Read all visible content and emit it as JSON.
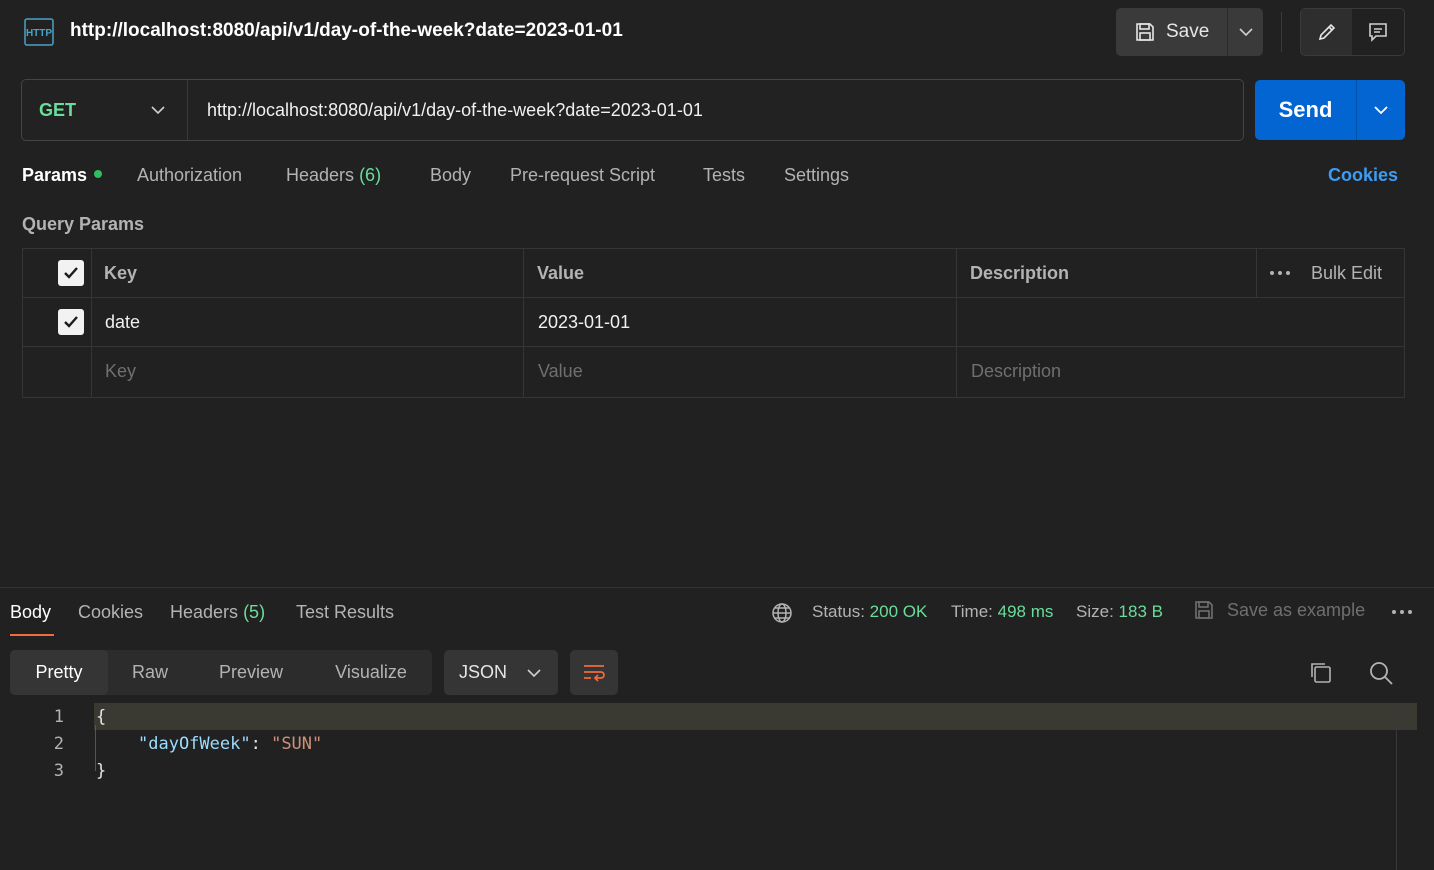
{
  "header": {
    "title": "http://localhost:8080/api/v1/day-of-the-week?date=2023-01-01",
    "save_label": "Save",
    "icons": {
      "request_type": "http-icon",
      "save": "save-icon",
      "edit": "pencil-icon",
      "comments": "comment-icon"
    }
  },
  "request": {
    "method": "GET",
    "url": "http://localhost:8080/api/v1/day-of-the-week?date=2023-01-01",
    "send_label": "Send"
  },
  "tabs": {
    "params": "Params",
    "authorization": "Authorization",
    "headers": "Headers",
    "headers_count": "(6)",
    "body": "Body",
    "prerequest": "Pre-request Script",
    "tests": "Tests",
    "settings": "Settings",
    "cookies": "Cookies"
  },
  "query_params": {
    "title": "Query Params",
    "columns": {
      "key": "Key",
      "value": "Value",
      "description": "Description",
      "bulk_edit": "Bulk Edit"
    },
    "rows": [
      {
        "checked": true,
        "key": "date",
        "value": "2023-01-01",
        "description": ""
      }
    ],
    "placeholders": {
      "key": "Key",
      "value": "Value",
      "description": "Description"
    }
  },
  "response": {
    "tabs": {
      "body": "Body",
      "cookies": "Cookies",
      "headers": "Headers",
      "headers_count": "(5)",
      "test_results": "Test Results"
    },
    "status_label": "Status:",
    "status": "200 OK",
    "time_label": "Time:",
    "time": "498 ms",
    "size_label": "Size:",
    "size": "183 B",
    "save_example": "Save as example",
    "views": {
      "pretty": "Pretty",
      "raw": "Raw",
      "preview": "Preview",
      "visualize": "Visualize"
    },
    "format": "JSON",
    "body_lines": [
      {
        "num": "1",
        "open": "{"
      },
      {
        "num": "2",
        "key": "\"dayOfWeek\"",
        "sep": ": ",
        "value": "\"SUN\""
      },
      {
        "num": "3",
        "close": "}"
      }
    ]
  },
  "colors": {
    "accent_send": "#0265d2",
    "method_get": "#6bdd9a",
    "status_ok": "#6bdd9a",
    "cookies_link": "#3b9df6",
    "active_tab_underline": "#f26b3a"
  }
}
